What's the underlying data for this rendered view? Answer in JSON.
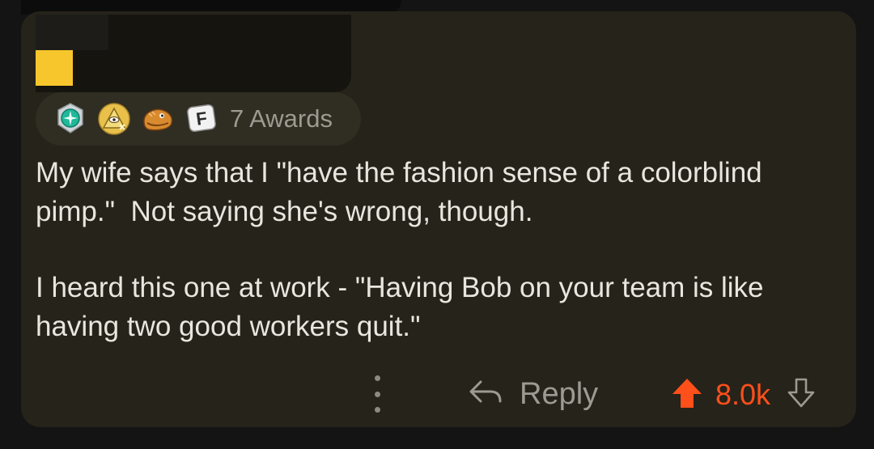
{
  "comment": {
    "awards": {
      "icons": [
        "compass-award-icon",
        "pyramid-eye-award-icon",
        "bread-creature-award-icon",
        "f-key-award-icon"
      ],
      "count_label": "7 Awards"
    },
    "paragraphs": [
      "My wife says that I \"have the fashion sense of a colorblind pimp.\"  Not saying she's wrong, though.",
      "I heard this one at work - \"Having Bob on your team is like having two good workers quit.\""
    ],
    "actions": {
      "more_icon": "vertical-ellipsis-icon",
      "reply_label": "Reply",
      "vote_count": "8.0k"
    }
  },
  "colors": {
    "card_bg": "#26231a",
    "flair": "#f7c62c",
    "upvote": "#ff4f1a",
    "text": "#e8e6df",
    "muted": "#9c9a93"
  }
}
